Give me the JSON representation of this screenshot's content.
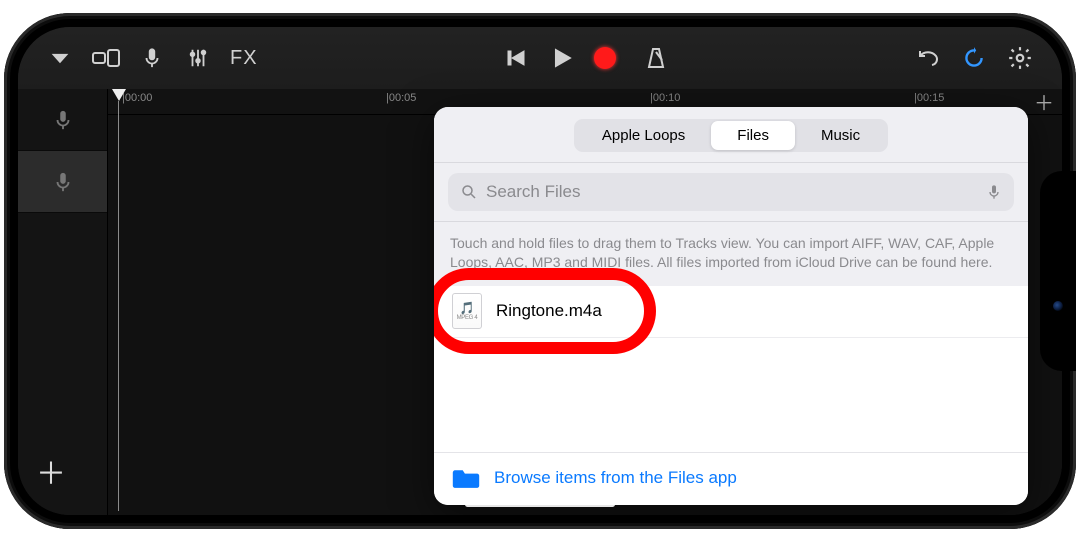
{
  "toolbar": {
    "fx_label": "FX"
  },
  "ruler": {
    "marks": [
      {
        "pos": 14,
        "label": "|00:00"
      },
      {
        "pos": 278,
        "label": "|00:05"
      },
      {
        "pos": 542,
        "label": "|00:10"
      },
      {
        "pos": 806,
        "label": "|00:15"
      }
    ]
  },
  "popover": {
    "tabs": {
      "apple_loops": "Apple Loops",
      "files": "Files",
      "music": "Music"
    },
    "search_placeholder": "Search Files",
    "hint_text": "Touch and hold files to drag them to Tracks view. You can import AIFF, WAV, CAF, Apple Loops, AAC, MP3 and MIDI files. All files imported from iCloud Drive can be found here.",
    "file": {
      "name": "Ringtone.m4a",
      "ext_label": "MPEG 4"
    },
    "browse_label": "Browse items from the Files app"
  },
  "colors": {
    "accent_blue": "#0a7aff",
    "record_red": "#ff1a1a",
    "highlight_red": "#ff0000"
  }
}
